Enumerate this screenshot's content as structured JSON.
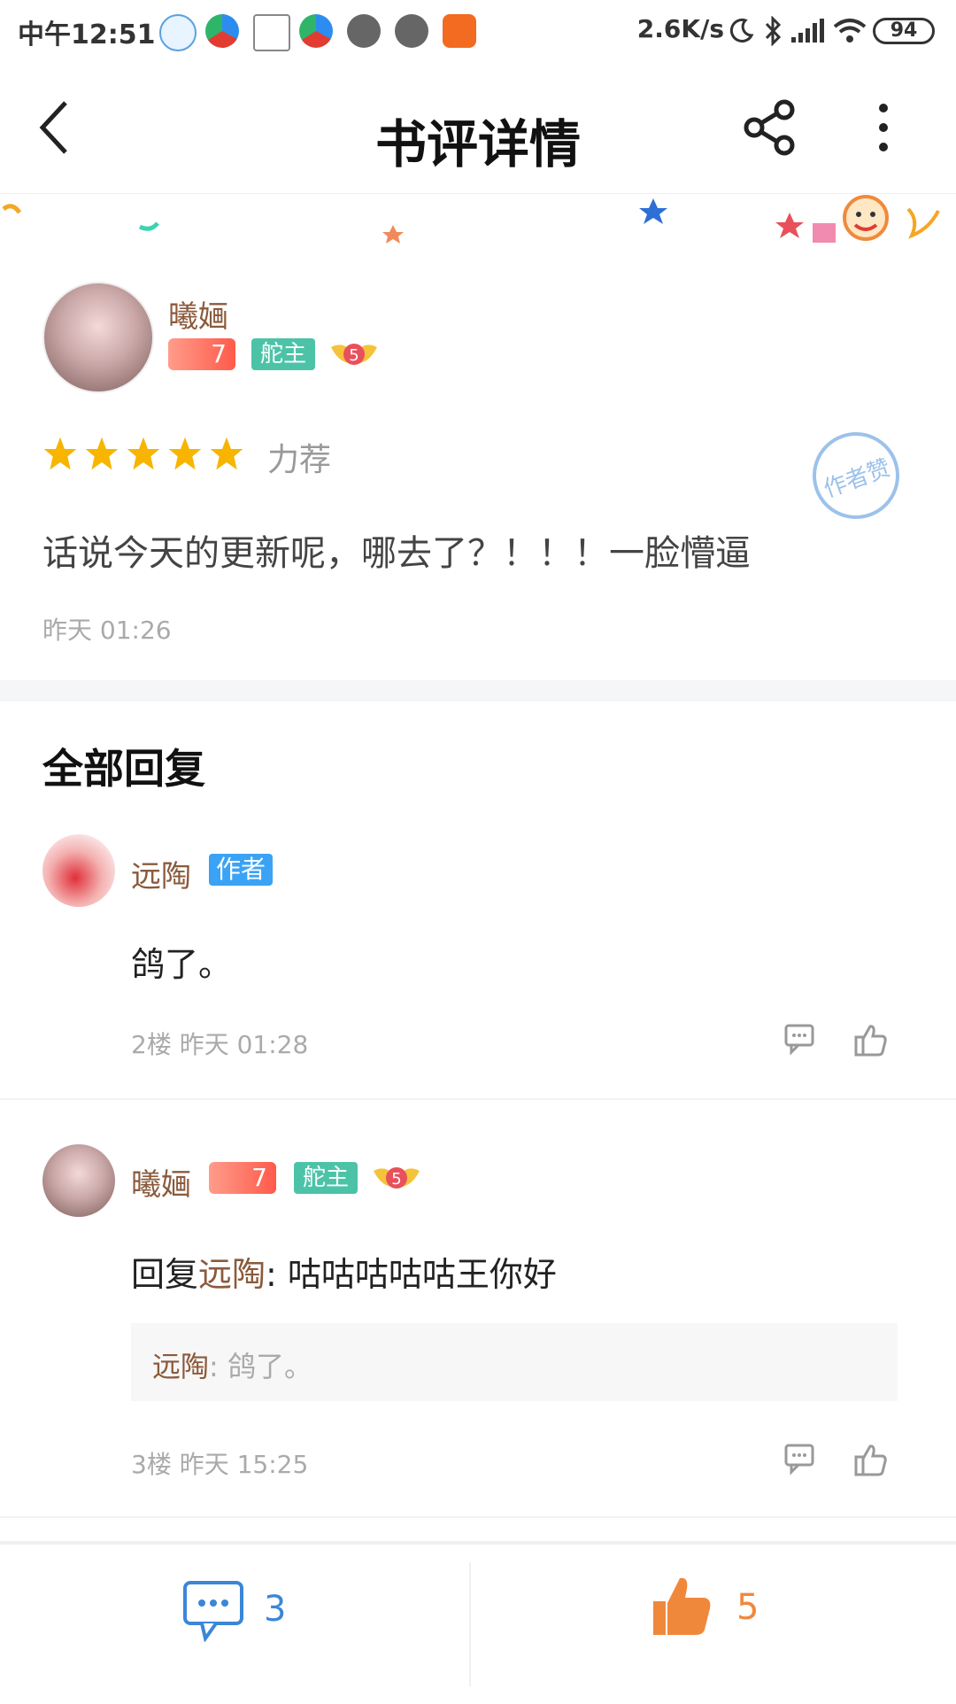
{
  "status_bar": {
    "time": "中午12:51",
    "speed": "2.6K/s",
    "battery": "94"
  },
  "header": {
    "title": "书评详情"
  },
  "review": {
    "user": {
      "name": "曦婳",
      "fan_level": "7",
      "role_badge": "舵主",
      "vip_level": "5"
    },
    "rating_stars": 5,
    "rating_label": "力荐",
    "stamp_text": "作者赞",
    "content": "话说今天的更新呢，哪去了？！！！一脸懵逼",
    "time": "昨天 01:26"
  },
  "replies_section": {
    "title": "全部回复",
    "replies": [
      {
        "name": "远陶",
        "badge": "作者",
        "text": "鸽了。",
        "floor_time": "2楼 昨天 01:28"
      },
      {
        "name": "曦婳",
        "fan_level": "7",
        "role_badge": "舵主",
        "vip_level": "5",
        "reply_prefix": "回复",
        "reply_to": "远陶",
        "reply_text": ": 咕咕咕咕咕王你好",
        "quote_name": "远陶",
        "quote_text": ": 鸽了。",
        "floor_time": "3楼 昨天 15:25"
      }
    ]
  },
  "bottom_bar": {
    "comment_count": "3",
    "like_count": "5"
  },
  "colors": {
    "username": "#8b5a3c",
    "comment_blue": "#3a87d8",
    "like_orange": "#f0883c",
    "badge_green": "#4cc3a7",
    "badge_blue": "#3aa3f5"
  }
}
